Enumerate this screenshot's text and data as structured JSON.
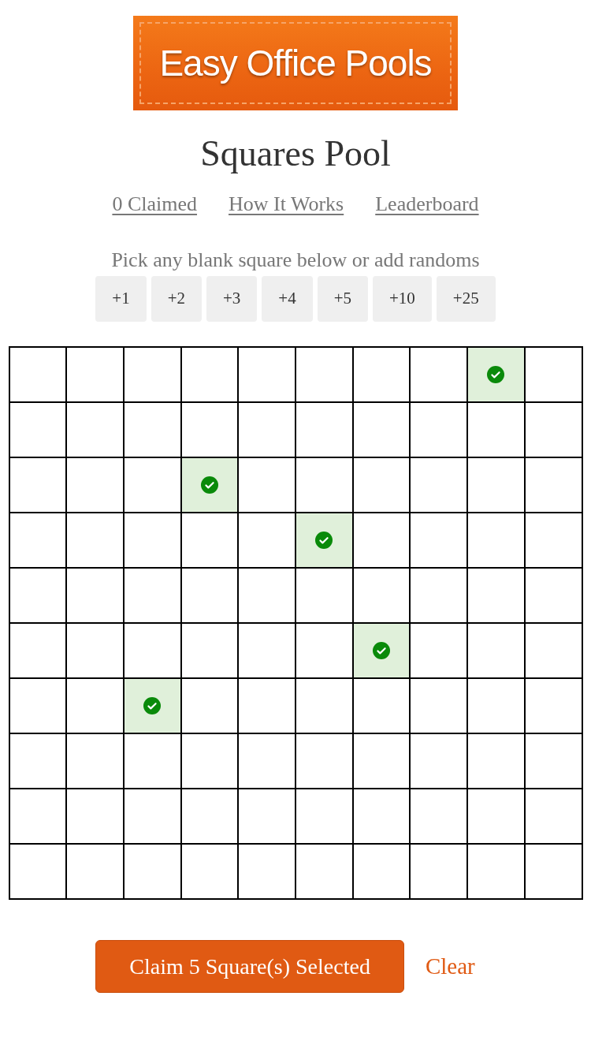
{
  "logo": {
    "text": "Easy Office Pools"
  },
  "title": "Squares Pool",
  "nav_links": [
    "0 Claimed",
    "How It Works",
    "Leaderboard"
  ],
  "instruction": "Pick any blank square below or add randoms",
  "random_buttons": [
    "+1",
    "+2",
    "+3",
    "+4",
    "+5",
    "+10",
    "+25"
  ],
  "grid": {
    "rows": [
      {
        "cells": [
          {
            "selected": false
          },
          {
            "selected": false
          },
          {
            "selected": false
          },
          {
            "selected": false
          },
          {
            "selected": false
          },
          {
            "selected": false
          },
          {
            "selected": false
          },
          {
            "selected": false
          },
          {
            "selected": true
          },
          {
            "selected": false
          }
        ]
      },
      {
        "cells": [
          {
            "selected": false
          },
          {
            "selected": false
          },
          {
            "selected": false
          },
          {
            "selected": false
          },
          {
            "selected": false
          },
          {
            "selected": false
          },
          {
            "selected": false
          },
          {
            "selected": false
          },
          {
            "selected": false
          },
          {
            "selected": false
          }
        ]
      },
      {
        "cells": [
          {
            "selected": false
          },
          {
            "selected": false
          },
          {
            "selected": false
          },
          {
            "selected": true
          },
          {
            "selected": false
          },
          {
            "selected": false
          },
          {
            "selected": false
          },
          {
            "selected": false
          },
          {
            "selected": false
          },
          {
            "selected": false
          }
        ]
      },
      {
        "cells": [
          {
            "selected": false
          },
          {
            "selected": false
          },
          {
            "selected": false
          },
          {
            "selected": false
          },
          {
            "selected": false
          },
          {
            "selected": true
          },
          {
            "selected": false
          },
          {
            "selected": false
          },
          {
            "selected": false
          },
          {
            "selected": false
          }
        ]
      },
      {
        "cells": [
          {
            "selected": false
          },
          {
            "selected": false
          },
          {
            "selected": false
          },
          {
            "selected": false
          },
          {
            "selected": false
          },
          {
            "selected": false
          },
          {
            "selected": false
          },
          {
            "selected": false
          },
          {
            "selected": false
          },
          {
            "selected": false
          }
        ]
      },
      {
        "cells": [
          {
            "selected": false
          },
          {
            "selected": false
          },
          {
            "selected": false
          },
          {
            "selected": false
          },
          {
            "selected": false
          },
          {
            "selected": false
          },
          {
            "selected": true
          },
          {
            "selected": false
          },
          {
            "selected": false
          },
          {
            "selected": false
          }
        ]
      },
      {
        "cells": [
          {
            "selected": false
          },
          {
            "selected": false
          },
          {
            "selected": true
          },
          {
            "selected": false
          },
          {
            "selected": false
          },
          {
            "selected": false
          },
          {
            "selected": false
          },
          {
            "selected": false
          },
          {
            "selected": false
          },
          {
            "selected": false
          }
        ]
      },
      {
        "cells": [
          {
            "selected": false
          },
          {
            "selected": false
          },
          {
            "selected": false
          },
          {
            "selected": false
          },
          {
            "selected": false
          },
          {
            "selected": false
          },
          {
            "selected": false
          },
          {
            "selected": false
          },
          {
            "selected": false
          },
          {
            "selected": false
          }
        ]
      },
      {
        "cells": [
          {
            "selected": false
          },
          {
            "selected": false
          },
          {
            "selected": false
          },
          {
            "selected": false
          },
          {
            "selected": false
          },
          {
            "selected": false
          },
          {
            "selected": false
          },
          {
            "selected": false
          },
          {
            "selected": false
          },
          {
            "selected": false
          }
        ]
      },
      {
        "cells": [
          {
            "selected": false
          },
          {
            "selected": false
          },
          {
            "selected": false
          },
          {
            "selected": false
          },
          {
            "selected": false
          },
          {
            "selected": false
          },
          {
            "selected": false
          },
          {
            "selected": false
          },
          {
            "selected": false
          },
          {
            "selected": false
          }
        ]
      }
    ]
  },
  "actions": {
    "claim_button": "Claim 5 Square(s) Selected",
    "clear_link": "Clear"
  }
}
